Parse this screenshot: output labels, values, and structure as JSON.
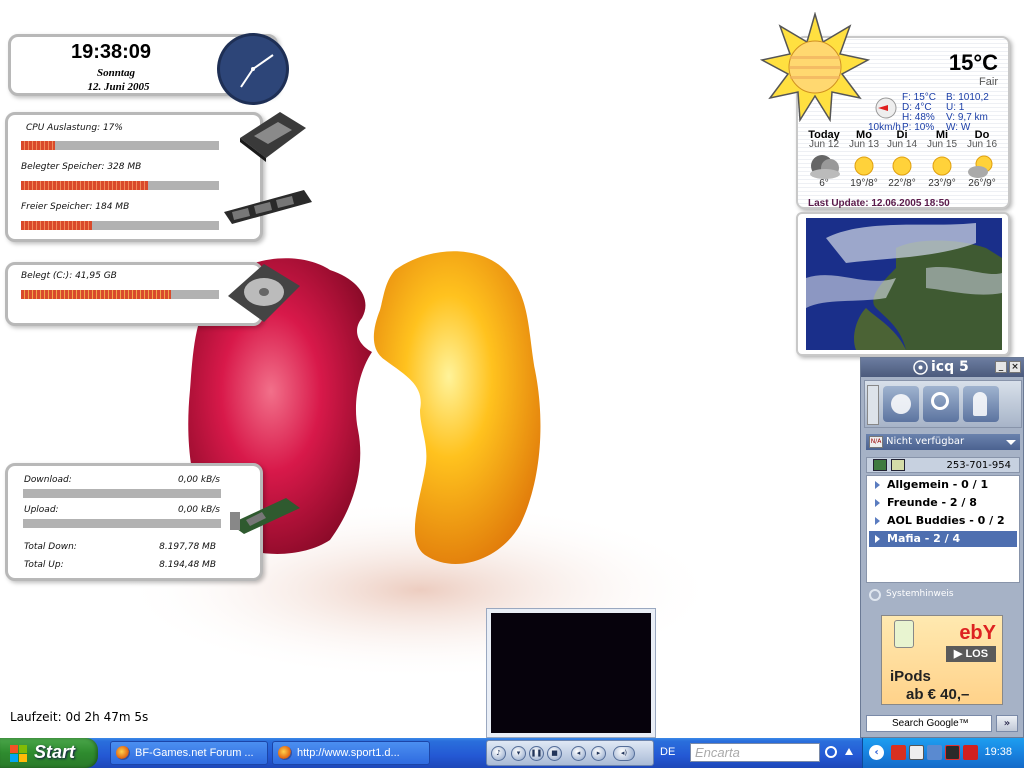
{
  "clock": {
    "time": "19:38:09",
    "weekday": "Sonntag",
    "date": "12. Juni 2005"
  },
  "system": {
    "cpu_label": "CPU Auslastung:  17%",
    "cpu_fraction": 0.17,
    "mem_used_label": "Belegter Speicher:  328 MB",
    "mem_used_fraction": 0.64,
    "mem_free_label": "Freier Speicher:  184 MB",
    "mem_free_fraction": 0.36
  },
  "disk": {
    "label": "Belegt (C:):  41,95 GB",
    "fraction": 0.76
  },
  "network": {
    "download_label": "Download:",
    "download_value": "0,00 kB/s",
    "upload_label": "Upload:",
    "upload_value": "0,00 kB/s",
    "total_down_label": "Total Down:",
    "total_down_value": "8.197,78 MB",
    "total_up_label": "Total Up:",
    "total_up_value": "8.194,48 MB"
  },
  "uptime": "Laufzeit: 0d 2h 47m 5s",
  "weather": {
    "temp": "15°C",
    "condition": "Fair",
    "details_left": [
      "F:  15°C",
      "D:   4°C",
      "H:  48%",
      "P:  10%"
    ],
    "details_right": [
      "B:  1010,2",
      "U:  1",
      "V:  9,7 km",
      "W:  W"
    ],
    "wind": "10km/h",
    "forecast": [
      {
        "day": "Today",
        "date": "Jun 12",
        "temps": "6°"
      },
      {
        "day": "Mo",
        "date": "Jun 13",
        "temps": "19°/8°"
      },
      {
        "day": "Di",
        "date": "Jun 14",
        "temps": "22°/8°"
      },
      {
        "day": "Mi",
        "date": "Jun 15",
        "temps": "23°/9°"
      },
      {
        "day": "Do",
        "date": "Jun 16",
        "temps": "26°/9°"
      }
    ],
    "last_update": "Last Update: 12.06.2005 18:50"
  },
  "icq": {
    "title": "icq 5",
    "status": "Nicht verfügbar",
    "uin": "253-701-954",
    "groups": [
      {
        "label": "Allgemein  - 0 / 1"
      },
      {
        "label": "Freunde  - 2 / 8"
      },
      {
        "label": "AOL Buddies  - 0 / 2"
      },
      {
        "label": "Mafia  - 2 / 4"
      }
    ],
    "system_notice": "Systemhinweis",
    "ad": {
      "brand": "ebY",
      "cta": "▶ LOS",
      "line1": "iPods",
      "line2": "ab € 40,–"
    },
    "search_label": "Search Google™",
    "search_go": "»"
  },
  "taskbar": {
    "start": "Start",
    "tasks": [
      {
        "label": "BF-Games.net Forum ..."
      },
      {
        "label": "http://www.sport1.d..."
      }
    ],
    "language": "DE",
    "encarta_placeholder": "Encarta",
    "time": "19:38"
  }
}
